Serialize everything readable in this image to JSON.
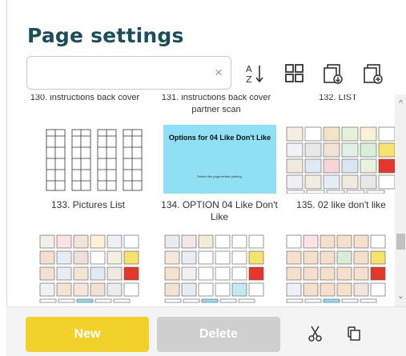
{
  "title": "Page settings",
  "search": {
    "value": "",
    "placeholder": "",
    "clear_glyph": "×"
  },
  "toolbar": {
    "icons": [
      "sort-az-icon",
      "grid-view-icon",
      "import-page-icon",
      "add-page-icon"
    ],
    "sort_label": "A↓Z"
  },
  "pages": [
    {
      "caption": "130. instructions back cover"
    },
    {
      "caption": "131. instructions back cover partner scan"
    },
    {
      "caption": "132. LIST"
    },
    {
      "caption": "133. Pictures List"
    },
    {
      "caption": "134. OPTION 04 Like Don't Like",
      "preview_title": "Options for 04 Like Don't Like",
      "preview_note": "Delete this page before printing."
    },
    {
      "caption": "135. 02 like don't like"
    },
    {
      "caption": ""
    },
    {
      "caption": ""
    },
    {
      "caption": ""
    }
  ],
  "buttons": {
    "new": "New",
    "delete": "Delete"
  },
  "bottom_icons": [
    "cut-icon",
    "copy-icon"
  ],
  "colors": {
    "title": "#1a4f59",
    "new_button": "#f2d22a",
    "delete_button": "#cfcfcf",
    "option_preview": "#8fe0f5"
  }
}
